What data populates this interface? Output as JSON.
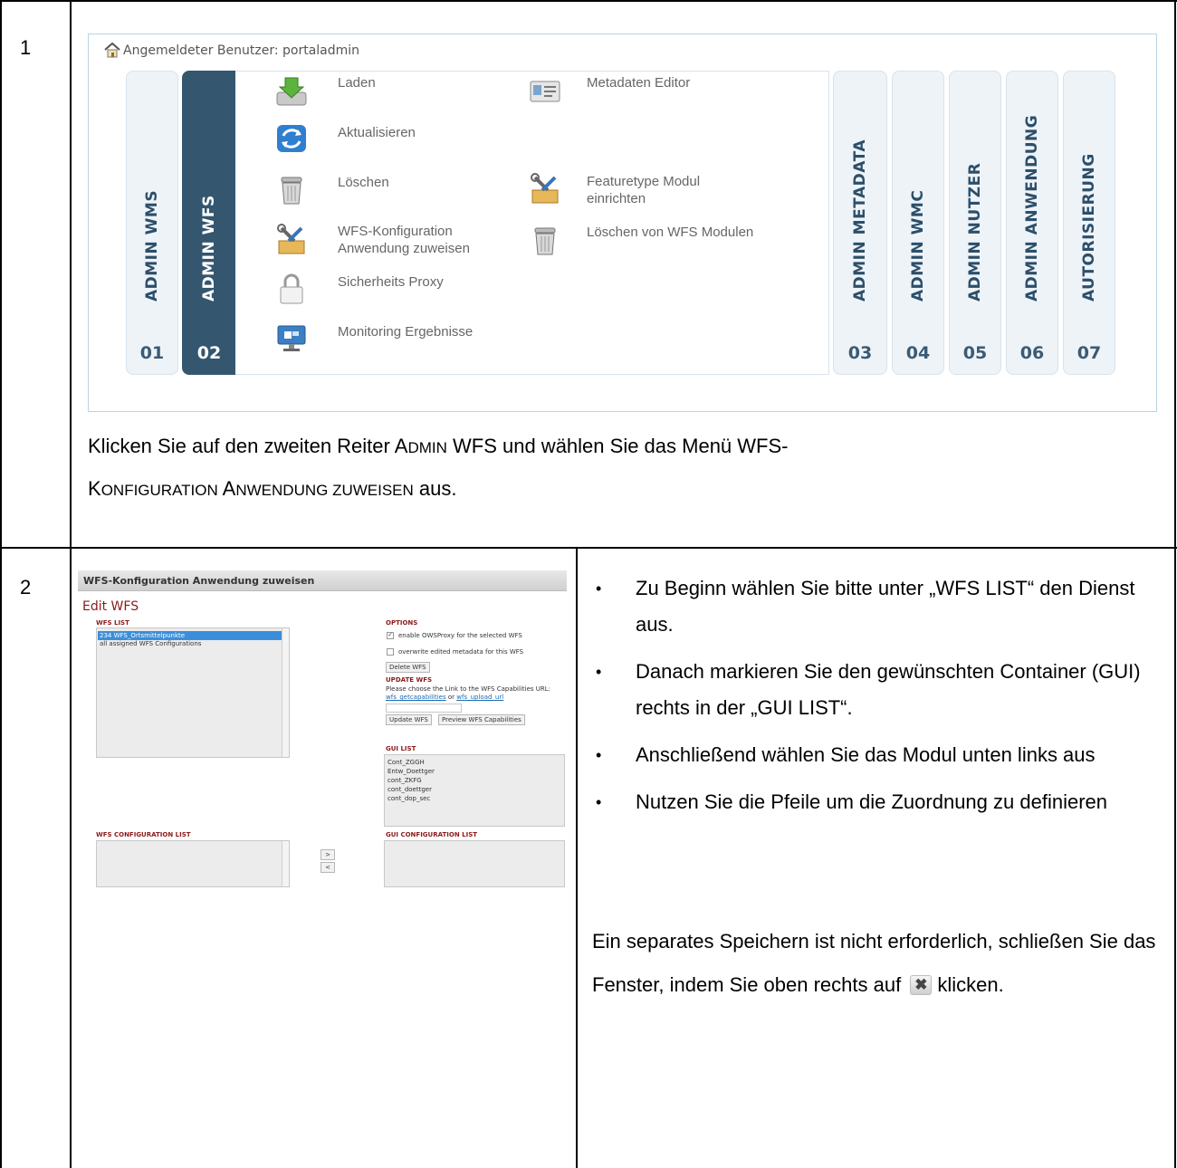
{
  "steps": [
    {
      "number": "1"
    },
    {
      "number": "2"
    }
  ],
  "step1": {
    "user_bar": "Angemeldeter Benutzer: portaladmin",
    "tabs": [
      {
        "label": "ADMIN WMS",
        "num": "01"
      },
      {
        "label": "ADMIN WFS",
        "num": "02"
      },
      {
        "label": "ADMIN METADATA",
        "num": "03"
      },
      {
        "label": "ADMIN WMC",
        "num": "04"
      },
      {
        "label": "ADMIN NUTZER",
        "num": "05"
      },
      {
        "label": "ADMIN ANWENDUNG",
        "num": "06"
      },
      {
        "label": "AUTORISIERUNG",
        "num": "07"
      }
    ],
    "active_tab": "02",
    "menu_left": [
      {
        "label": "Laden",
        "icon": "download-icon"
      },
      {
        "label": "Aktualisieren",
        "icon": "refresh-icon"
      },
      {
        "label": "Löschen",
        "icon": "trash-icon"
      },
      {
        "label": "WFS-Konfiguration Anwendung zuweisen",
        "icon": "tools-icon"
      },
      {
        "label": "Sicherheits Proxy",
        "icon": "lock-icon"
      },
      {
        "label": "Monitoring Ergebnisse",
        "icon": "monitor-icon"
      }
    ],
    "menu_right": [
      {
        "label": "Metadaten Editor",
        "icon": "id-card-icon"
      },
      {
        "label": "Featuretype Modul einrichten",
        "icon": "tools-icon"
      },
      {
        "label": "Löschen von WFS Modulen",
        "icon": "trash-icon"
      }
    ],
    "caption": {
      "p1": "Klicken Sie auf den zweiten Reiter ",
      "sc1_cap": "A",
      "sc1_rest": "DMIN",
      "p2": " WFS und wählen Sie das Menü WFS-",
      "sc2_cap": "K",
      "sc2_rest": "ONFIGURATION",
      "sp": " ",
      "sc3_cap": "A",
      "sc3_rest": "NWENDUNG ZUWEISEN",
      "p3": " aus."
    }
  },
  "step2": {
    "window_title": "WFS-Konfiguration Anwendung zuweisen",
    "heading": "Edit WFS",
    "wfs_list": {
      "title": "WFS LIST",
      "items": [
        "234 WFS_Ortsmittelpunkte",
        "all assigned WFS Configurations"
      ]
    },
    "options": {
      "title": "OPTIONS",
      "opt1": "enable OWSProxy for the selected WFS",
      "opt2": "overwrite edited metadata for this WFS",
      "delete_btn": "Delete WFS"
    },
    "update": {
      "title": "UPDATE WFS",
      "text": "Please choose the Link to the WFS Capabilities URL:",
      "link1": "wfs_getcapabilities",
      "or": " or ",
      "link2": "wfs_upload_url",
      "update_btn": "Update WFS",
      "preview_btn": "Preview WFS Capabilities"
    },
    "gui_list": {
      "title": "GUI LIST",
      "items": [
        "Cont_ZGGH",
        "Entw_Doettger",
        "cont_ZKFG",
        "cont_doettger",
        "cont_dop_sec"
      ]
    },
    "wfs_conf_title": "WFS CONFIGURATION LIST",
    "gui_conf_title": "GUI CONFIGURATION LIST",
    "arrow_right": ">",
    "arrow_left": "<",
    "bullets": [
      "Zu Beginn wählen Sie bitte unter „WFS LIST“ den Dienst aus.",
      "Danach markieren Sie den gewünschten Container (GUI) rechts in der „GUI LIST“.",
      "Anschließend wählen Sie das Modul unten links aus",
      "Nutzen Sie die Pfeile um die Zuordnung zu definieren"
    ],
    "bullet_glyph": "•",
    "closing": {
      "before": "Ein separates Speichern ist nicht erforderlich, schließen Sie das Fenster, indem Sie oben rechts auf",
      "x": "✖",
      "after": "klicken."
    }
  }
}
